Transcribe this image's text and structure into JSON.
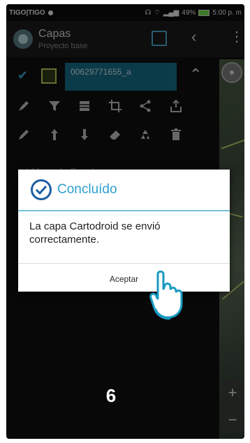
{
  "status_bar": {
    "carrier": "TIGO|TIGO",
    "battery": "49%",
    "time": "5:00 p. m"
  },
  "app_bar": {
    "title": "Capas",
    "subtitle": "Proyecto base"
  },
  "layer": {
    "name": "00629771655_a"
  },
  "background_layer": {
    "label": "Mapa de Google"
  },
  "dialog": {
    "title": "Concluído",
    "message": "La capa Cartodroid se envió correctamente.",
    "button_label": "Aceptar"
  },
  "step_label": "6",
  "colors": {
    "accent": "#2da0cf",
    "layer_highlight": "#156a86",
    "dialog_divider": "#74c1de"
  }
}
